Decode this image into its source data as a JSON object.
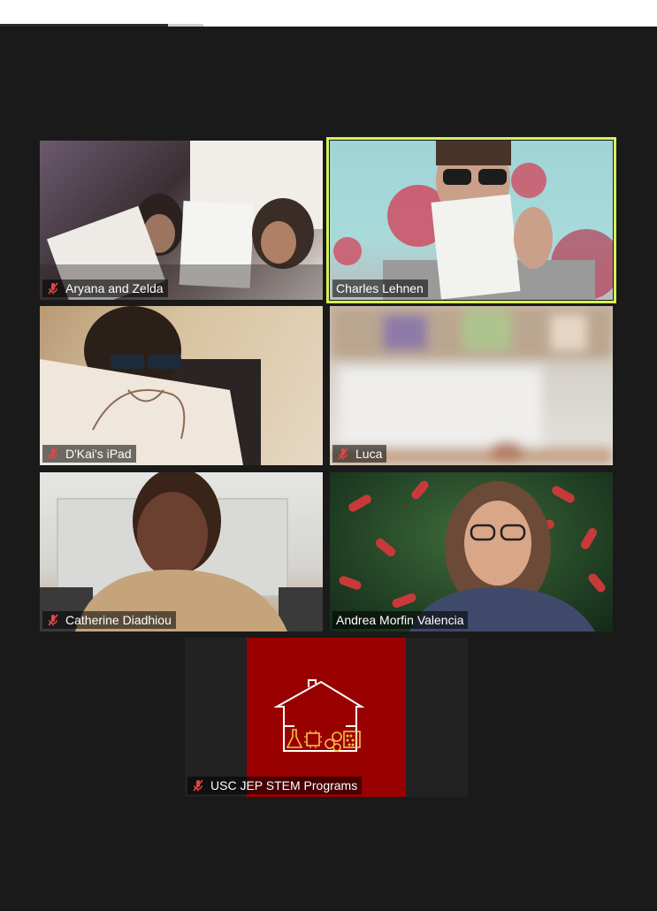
{
  "window": {
    "background": "#1a1a1a",
    "active_speaker_border": "#d4f25a"
  },
  "participants": [
    {
      "name": "Aryana and Zelda",
      "muted": true
    },
    {
      "name": "Charles Lehnen",
      "muted": false,
      "active_speaker": true
    },
    {
      "name": "D'Kai's iPad",
      "muted": true
    },
    {
      "name": "Luca",
      "muted": true
    },
    {
      "name": "Catherine Diadhiou",
      "muted": true
    },
    {
      "name": "Andrea Morfin Valencia",
      "muted": false
    },
    {
      "name": "USC JEP STEM Programs",
      "muted": true,
      "avatar": "house-logo-icon",
      "avatar_bg": "#990000"
    }
  ],
  "icons": {
    "mute": "mic-muted-icon"
  }
}
